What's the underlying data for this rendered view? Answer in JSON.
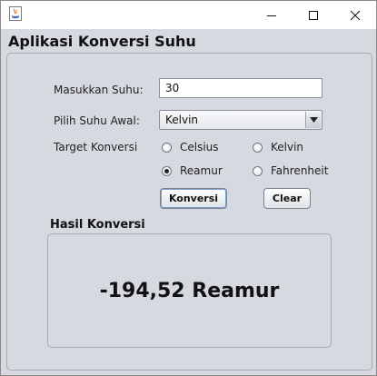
{
  "window": {
    "app_icon": "java-icon",
    "controls": {
      "minimize": "minimize-icon",
      "maximize": "maximize-icon",
      "close": "close-icon"
    }
  },
  "app": {
    "title": "Aplikasi Konversi Suhu"
  },
  "form": {
    "input_label": "Masukkan Suhu:",
    "input_value": "30",
    "source_label": "Pilih Suhu Awal:",
    "source_selected": "Kelvin",
    "target_label": "Target Konversi",
    "target_options": [
      {
        "label": "Celsius",
        "checked": false
      },
      {
        "label": "Kelvin",
        "checked": false
      },
      {
        "label": "Reamur",
        "checked": true
      },
      {
        "label": "Fahrenheit",
        "checked": false
      }
    ],
    "convert_button": "Konversi",
    "clear_button": "Clear"
  },
  "result": {
    "heading": "Hasil Konversi",
    "value": "-194,52 Reamur"
  }
}
